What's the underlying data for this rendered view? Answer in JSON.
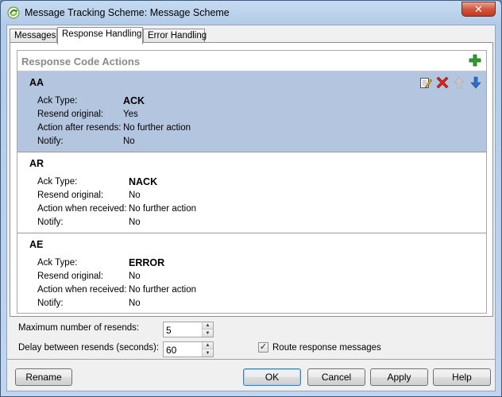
{
  "window": {
    "title": "Message Tracking Scheme: Message Scheme",
    "close_glyph": "✕"
  },
  "tabs": [
    {
      "label": "Messages",
      "active": false
    },
    {
      "label": "Response Handling",
      "active": true
    },
    {
      "label": "Error Handling",
      "active": false
    }
  ],
  "response_code_actions": {
    "title": "Response Code Actions",
    "items": [
      {
        "code": "AA",
        "selected": true,
        "fields": [
          {
            "label": "Ack Type:",
            "value": "ACK"
          },
          {
            "label": "Resend original:",
            "value": "Yes"
          },
          {
            "label": "Action after resends:",
            "value": "No further action"
          },
          {
            "label": "Notify:",
            "value": "No"
          }
        ]
      },
      {
        "code": "AR",
        "selected": false,
        "fields": [
          {
            "label": "Ack Type:",
            "value": "NACK"
          },
          {
            "label": "Resend original:",
            "value": "No"
          },
          {
            "label": "Action when received:",
            "value": "No further action"
          },
          {
            "label": "Notify:",
            "value": "No"
          }
        ]
      },
      {
        "code": "AE",
        "selected": false,
        "fields": [
          {
            "label": "Ack Type:",
            "value": "ERROR"
          },
          {
            "label": "Resend original:",
            "value": "No"
          },
          {
            "label": "Action when received:",
            "value": "No further action"
          },
          {
            "label": "Notify:",
            "value": "No"
          }
        ]
      }
    ]
  },
  "settings": {
    "max_resends_label": "Maximum number of resends:",
    "max_resends_value": "5",
    "delay_label": "Delay between resends (seconds):",
    "delay_value": "60",
    "route_label": "Route response messages",
    "route_checked": true,
    "check_glyph": "✓",
    "spin_up_glyph": "▲",
    "spin_down_glyph": "▼"
  },
  "buttons": {
    "rename": "Rename",
    "ok": "OK",
    "cancel": "Cancel",
    "apply": "Apply",
    "help": "Help"
  },
  "colors": {
    "selected_row": "#b4c6df",
    "add_icon": "#2e9e2e",
    "delete_icon": "#d9251d",
    "down_arrow": "#2a6fcf",
    "up_arrow_disabled": "#b9b9b9"
  }
}
